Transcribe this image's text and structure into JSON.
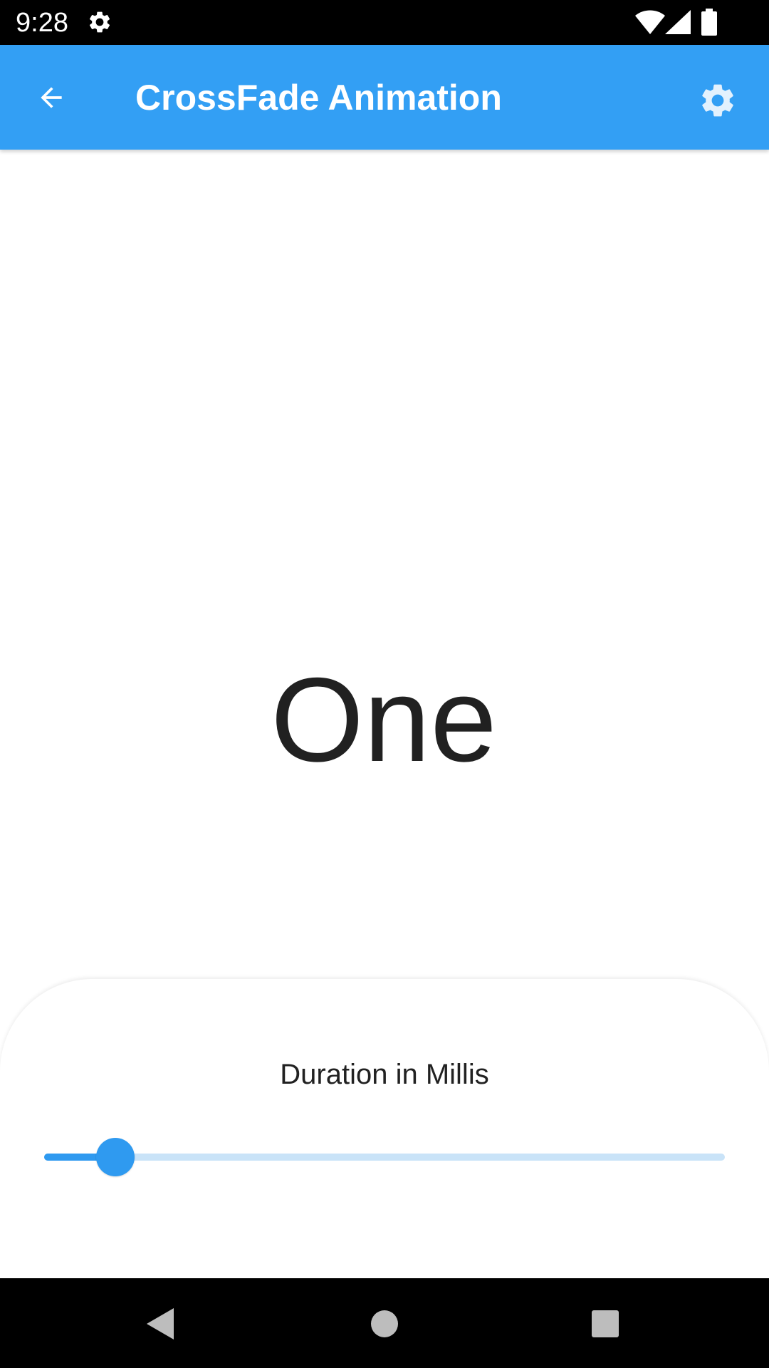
{
  "status_bar": {
    "time": "9:28",
    "icons": [
      "settings-gear-icon",
      "wifi-icon",
      "cellular-signal-icon",
      "battery-icon"
    ]
  },
  "app_bar": {
    "title": "CrossFade Animation",
    "back_icon": "arrow-back-icon",
    "settings_icon": "settings-gear-icon",
    "background_color": "#339ff4"
  },
  "main": {
    "crossfade_text": "One"
  },
  "controls": {
    "slider_label": "Duration in Millis",
    "slider_value_fraction": 0.105,
    "slider_active_color": "#2f9af0",
    "slider_inactive_color": "#c9e3f8"
  },
  "nav_bar": {
    "buttons": [
      "back-triangle-icon",
      "home-circle-icon",
      "recents-square-icon"
    ]
  }
}
